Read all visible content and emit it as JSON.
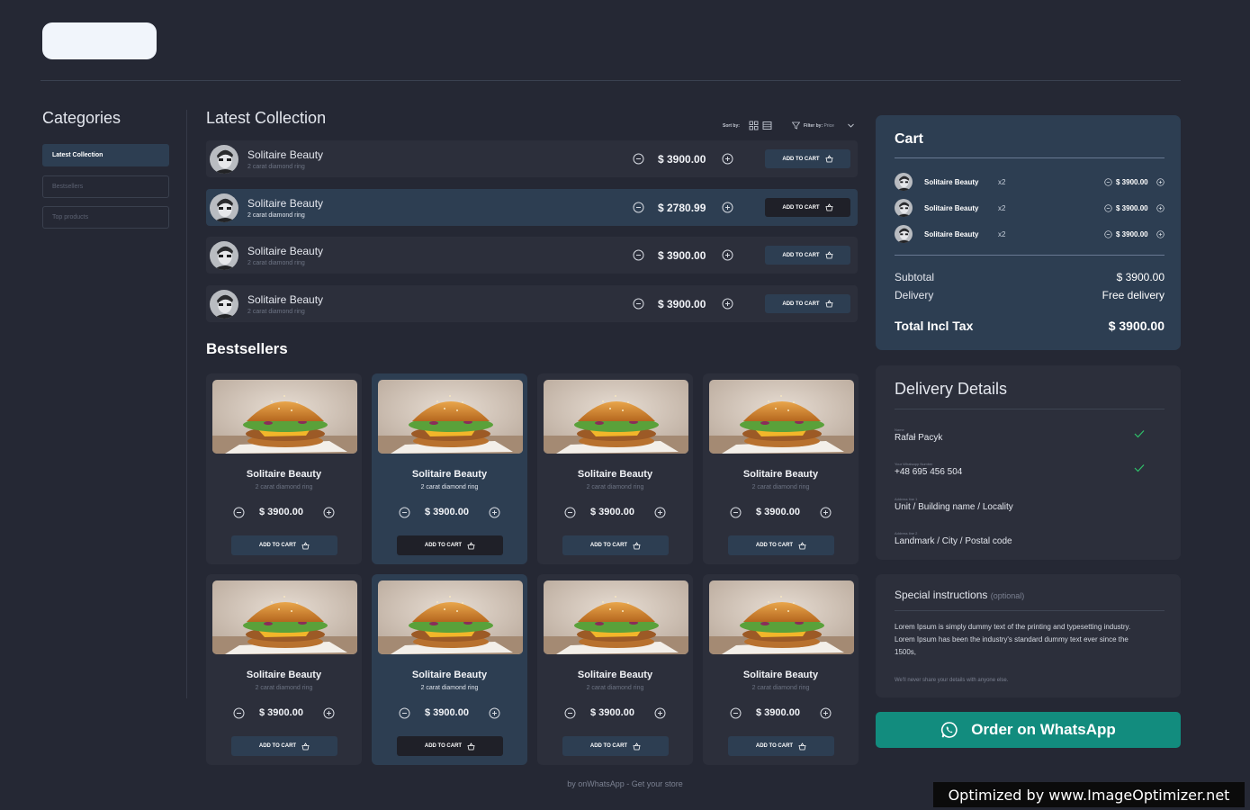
{
  "colors": {
    "background": "#252834",
    "panel": "#2c2f3b",
    "accent_panel": "#2d3e52",
    "whatsapp": "#128c7e",
    "check": "#2fc16a"
  },
  "categories": {
    "title": "Categories",
    "items": [
      {
        "label": "Latest Collection",
        "active": true
      },
      {
        "label": "Bestsellers",
        "active": false
      },
      {
        "label": "Top products",
        "active": false
      }
    ]
  },
  "latest": {
    "title": "Latest Collection",
    "sort_label": "Sort by:",
    "filter_label": "Filter by:",
    "filter_value": "Price",
    "rows": [
      {
        "name": "Solitaire Beauty",
        "sub": "2 carat diamond ring",
        "price": "$ 3900.00",
        "add_label": "ADD TO CART"
      },
      {
        "name": "Solitaire Beauty",
        "sub": "2 carat diamond ring",
        "price": "$ 2780.99",
        "add_label": "ADD TO CART"
      },
      {
        "name": "Solitaire Beauty",
        "sub": "2 carat diamond ring",
        "price": "$ 3900.00",
        "add_label": "ADD TO CART"
      },
      {
        "name": "Solitaire Beauty",
        "sub": "2 carat diamond ring",
        "price": "$ 3900.00",
        "add_label": "ADD TO CART"
      }
    ]
  },
  "bestsellers": {
    "title": "Bestsellers",
    "cards": [
      {
        "name": "Solitaire Beauty",
        "sub": "2 carat diamond ring",
        "price": "$ 3900.00",
        "add_label": "ADD TO CART"
      },
      {
        "name": "Solitaire Beauty",
        "sub": "2 carat diamond ring",
        "price": "$ 3900.00",
        "add_label": "ADD TO CART"
      },
      {
        "name": "Solitaire Beauty",
        "sub": "2 carat diamond ring",
        "price": "$ 3900.00",
        "add_label": "ADD TO CART"
      },
      {
        "name": "Solitaire Beauty",
        "sub": "2 carat diamond ring",
        "price": "$ 3900.00",
        "add_label": "ADD TO CART"
      },
      {
        "name": "Solitaire Beauty",
        "sub": "2 carat diamond ring",
        "price": "$ 3900.00",
        "add_label": "ADD TO CART"
      },
      {
        "name": "Solitaire Beauty",
        "sub": "2 carat diamond ring",
        "price": "$ 3900.00",
        "add_label": "ADD TO CART"
      },
      {
        "name": "Solitaire Beauty",
        "sub": "2 carat diamond ring",
        "price": "$ 3900.00",
        "add_label": "ADD TO CART"
      },
      {
        "name": "Solitaire Beauty",
        "sub": "2 carat diamond ring",
        "price": "$ 3900.00",
        "add_label": "ADD TO CART"
      }
    ]
  },
  "cart": {
    "title": "Cart",
    "items": [
      {
        "name": "Solitaire Beauty",
        "qty": "x2",
        "price": "$ 3900.00"
      },
      {
        "name": "Solitaire Beauty",
        "qty": "x2",
        "price": "$ 3900.00"
      },
      {
        "name": "Solitaire Beauty",
        "qty": "x2",
        "price": "$ 3900.00"
      }
    ],
    "subtotal_label": "Subtotal",
    "subtotal_value": "$ 3900.00",
    "delivery_label": "Delivery",
    "delivery_value": "Free delivery",
    "total_label": "Total Incl Tax",
    "total_value": "$ 3900.00"
  },
  "delivery": {
    "title": "Delivery Details",
    "fields": [
      {
        "label": "Name",
        "value": "Rafał Pacyk",
        "placeholder": ""
      },
      {
        "label": "Your Whatsapp Number",
        "value": "+48 695 456 504",
        "placeholder": ""
      },
      {
        "label": "Address line 1",
        "value": "",
        "placeholder": "Unit / Building name / Locality"
      },
      {
        "label": "Address line 2",
        "value": "",
        "placeholder": "Landmark / City / Postal code"
      }
    ]
  },
  "special": {
    "title": "Special instructions",
    "optional": "(optional)",
    "body": "Lorem Ipsum is simply dummy text of the printing and typesetting industry. Lorem Ipsum has been the industry's standard dummy text ever since the 1500s,",
    "note": "We'll never share your details with anyone else."
  },
  "order_button": {
    "label": "Order on WhatsApp",
    "icon": "whatsapp-icon"
  },
  "footer": {
    "text": "by onWhatsApp - Get your store"
  },
  "badge": {
    "text": "Optimized by www.ImageOptimizer.net"
  }
}
